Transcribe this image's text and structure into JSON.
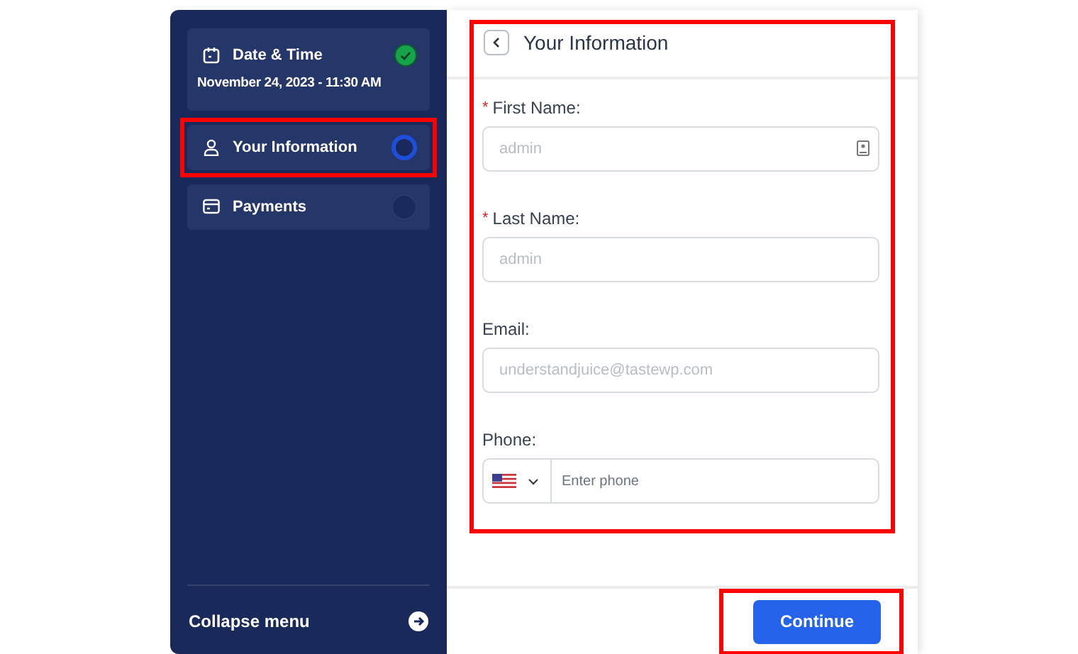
{
  "sidebar": {
    "steps": [
      {
        "title": "Date & Time",
        "subtitle": "November 24, 2023 - 11:30 AM",
        "kind": "done",
        "highlighted": false
      },
      {
        "title": "Your Information",
        "kind": "current",
        "highlighted": true
      },
      {
        "title": "Payments",
        "kind": "pending",
        "highlighted": false
      }
    ],
    "collapse": {
      "label": "Collapse menu"
    }
  },
  "panel": {
    "title": "Your Information",
    "highlighted": true,
    "fields": [
      {
        "kind": "text",
        "required_mark": "*",
        "label": "First Name:",
        "value": "admin",
        "autofill_icon": true
      },
      {
        "kind": "text",
        "required_mark": "*",
        "label": "Last Name:",
        "value": "admin",
        "autofill_icon": false
      },
      {
        "kind": "text",
        "label": "Email:",
        "value": "understandjuice@tastewp.com",
        "autofill_icon": false
      },
      {
        "kind": "phone",
        "label": "Phone:",
        "placeholder": "Enter phone"
      }
    ]
  },
  "footer": {
    "button": {
      "label": "Continue",
      "highlighted": true
    }
  }
}
